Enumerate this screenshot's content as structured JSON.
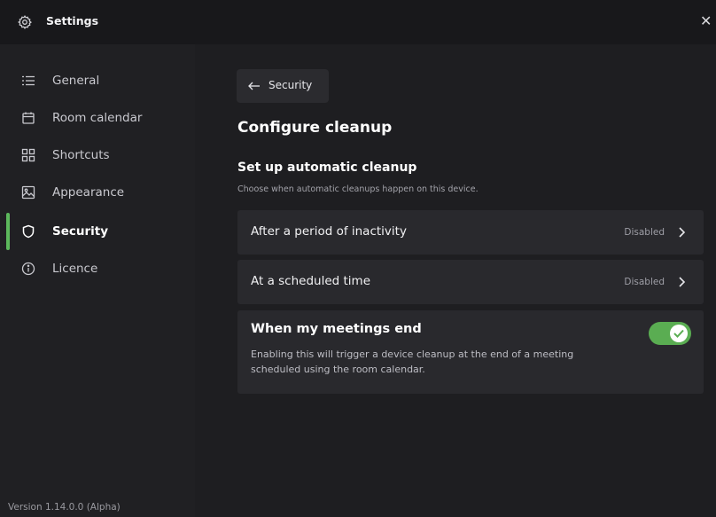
{
  "window": {
    "title": "Settings",
    "icon": "gear-icon",
    "close_glyph": "✕"
  },
  "sidebar": {
    "items": [
      {
        "label": "General",
        "icon": "list-icon",
        "active": false
      },
      {
        "label": "Room calendar",
        "icon": "calendar-icon",
        "active": false
      },
      {
        "label": "Shortcuts",
        "icon": "grid-icon",
        "active": false
      },
      {
        "label": "Appearance",
        "icon": "image-icon",
        "active": false
      },
      {
        "label": "Security",
        "icon": "shield-icon",
        "active": true
      },
      {
        "label": "Licence",
        "icon": "info-icon",
        "active": false
      }
    ],
    "version": "Version 1.14.0.0 (Alpha)",
    "accent_color": "#5cb85c"
  },
  "main": {
    "back_button": {
      "label": "Security",
      "icon": "arrow-left-icon"
    },
    "page_title": "Configure cleanup",
    "section_title": "Set up automatic cleanup",
    "section_description": "Choose when automatic cleanups happen on this device.",
    "options": [
      {
        "label": "After a period of inactivity",
        "status": "Disabled"
      },
      {
        "label": "At a scheduled time",
        "status": "Disabled"
      }
    ],
    "meeting_end": {
      "label": "When my meetings end",
      "description": "Enabling this will trigger a device cleanup at the end of a meeting scheduled using the room calendar.",
      "enabled": true,
      "toggle_color": "#5aad52"
    }
  }
}
